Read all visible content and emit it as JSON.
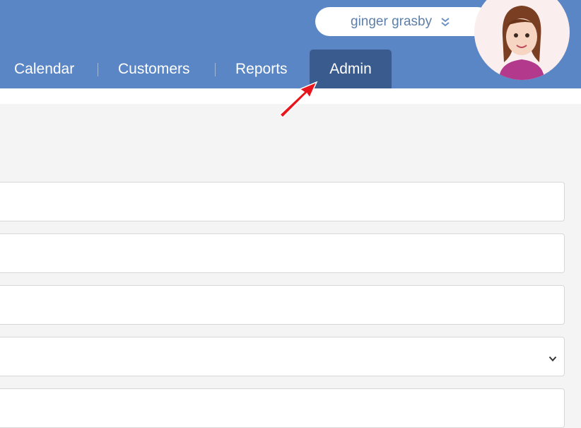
{
  "user": {
    "name": "ginger grasby"
  },
  "nav": {
    "items": [
      {
        "label": "Calendar"
      },
      {
        "label": "Customers"
      },
      {
        "label": "Reports"
      },
      {
        "label": "Admin"
      }
    ],
    "active": "Admin"
  },
  "colors": {
    "header_bg": "#5a86c5",
    "active_tab": "#3a5b8d",
    "arrow": "#e8161c"
  }
}
